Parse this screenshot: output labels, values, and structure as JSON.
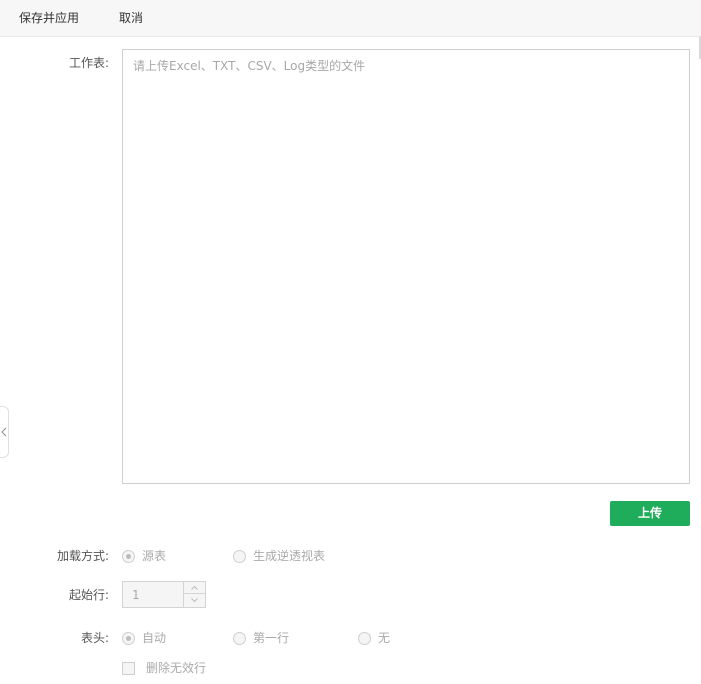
{
  "toolbar": {
    "save_label": "保存并应用",
    "cancel_label": "取消"
  },
  "worksheet": {
    "label": "工作表:",
    "placeholder": "请上传Excel、TXT、CSV、Log类型的文件",
    "upload_label": "上传"
  },
  "load_mode": {
    "label": "加载方式:",
    "options": [
      {
        "label": "源表",
        "checked": true
      },
      {
        "label": "生成逆透视表",
        "checked": false
      }
    ]
  },
  "start_row": {
    "label": "起始行:",
    "value": "1"
  },
  "header": {
    "label": "表头:",
    "options": [
      {
        "label": "自动",
        "checked": true
      },
      {
        "label": "第一行",
        "checked": false
      },
      {
        "label": "无",
        "checked": false
      }
    ],
    "delete_invalid_label": "删除无效行"
  },
  "colors": {
    "accent": "#1fad5b"
  }
}
